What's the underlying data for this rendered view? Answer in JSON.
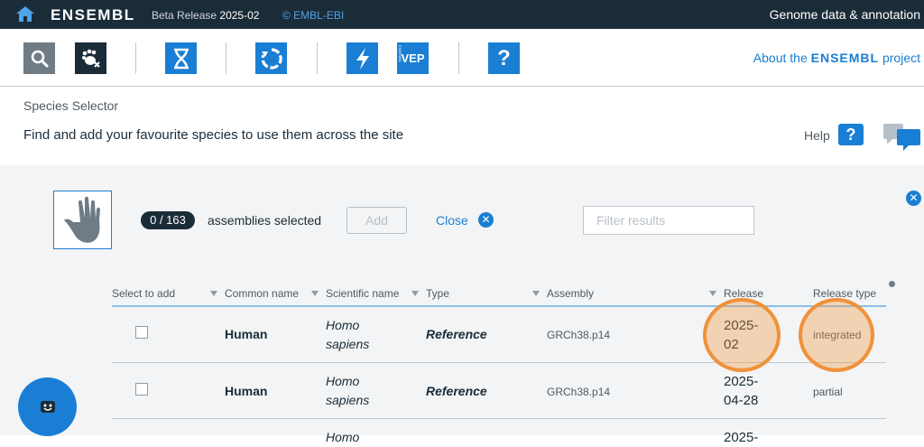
{
  "topbar": {
    "brand": "ENSEMBL",
    "release_prefix": "Beta Release",
    "release_version": "2025-02",
    "embl": "© EMBL-EBI",
    "tagline": "Genome data & annotation"
  },
  "launchbar": {
    "items": [
      {
        "name": "search-icon"
      },
      {
        "name": "species-selector-icon"
      },
      {
        "name": "genome-browser-icon"
      },
      {
        "name": "entity-viewer-icon"
      },
      {
        "name": "blast-icon"
      },
      {
        "name": "vep-icon",
        "label": "VEP",
        "sublabel": "ENSEMBL"
      },
      {
        "name": "help-icon",
        "label": "?"
      }
    ],
    "about_prefix": "About the",
    "about_brand": "ENSEMBL",
    "about_suffix": "project"
  },
  "header": {
    "title": "Species Selector",
    "description": "Find and add your favourite species to use them across the site",
    "help_label": "Help",
    "help_button": "?"
  },
  "selection": {
    "count": "0 / 163",
    "count_label": "assemblies selected",
    "add_label": "Add",
    "close_label": "Close",
    "filter_placeholder": "Filter results"
  },
  "table": {
    "columns": [
      "Select to add",
      "Common name",
      "Scientific name",
      "Type",
      "Assembly",
      "Release",
      "Release type"
    ],
    "rows": [
      {
        "common": "Human",
        "sci1": "Homo",
        "sci2": "sapiens",
        "type": "Reference",
        "assembly": "GRCh38.p14",
        "rel1": "2025-",
        "rel2": "02",
        "rtype": "integrated"
      },
      {
        "common": "Human",
        "sci1": "Homo",
        "sci2": "sapiens",
        "type": "Reference",
        "assembly": "GRCh38.p14",
        "rel1": "2025-",
        "rel2": "04-28",
        "rtype": "partial"
      },
      {
        "common": "",
        "sci1": "Homo",
        "sci2": "",
        "type": "",
        "assembly": "",
        "rel1": "2025-",
        "rel2": "",
        "rtype": ""
      }
    ]
  },
  "colors": {
    "dark": "#1b2c39",
    "blue": "#1a7fd4",
    "highlight": "#f0913a",
    "panel": "#f2f4f5"
  }
}
